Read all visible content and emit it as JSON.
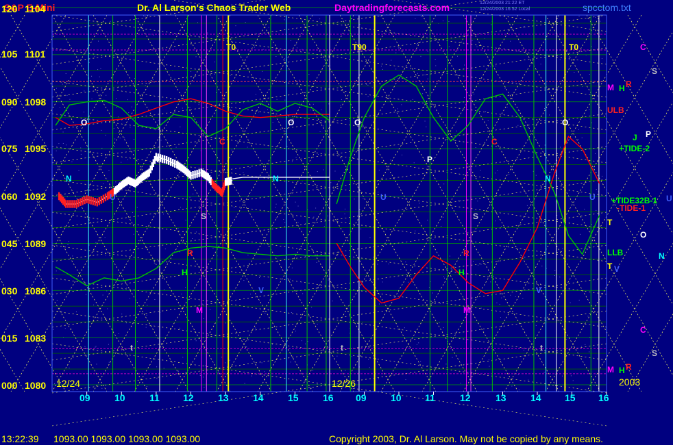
{
  "header": {
    "symbol": "S&P E-Mini",
    "title": "Dr. Al Larson's Chaos Trader Web",
    "site": "Daytradingforecasts.com",
    "stamp1": "12/24/2003 21:22 ET",
    "stamp2": "12/24/2003 16:52 Local",
    "file": "spcctom.txt"
  },
  "footer": {
    "time": "13:22:39",
    "quotes": "1093.00 1093.00 1093.00 1093.00",
    "copyright": "Copyright 2003, Dr. Al Larson. May not be copied by any means."
  },
  "colors": {
    "background": "#000080",
    "grid_green": "#00c000",
    "grid_yellow": "#ffff00",
    "cyan": "#00ffff",
    "magenta": "#ff00ff",
    "red": "#ff0000",
    "white": "#ffffff"
  },
  "chart_data": {
    "type": "line",
    "left_axis_labels": [
      "120",
      "105",
      "090",
      "075",
      "060",
      "045",
      "030",
      "015",
      "000"
    ],
    "price_axis_labels": [
      "1104",
      "1101",
      "1098",
      "1095",
      "1092",
      "1089",
      "1086",
      "1083",
      "1080"
    ],
    "ylim": [
      1080,
      1104
    ],
    "x_ticks_day1": [
      "09",
      "10",
      "11",
      "12",
      "13",
      "14",
      "15",
      "16"
    ],
    "x_ticks_day2": [
      "09",
      "10",
      "11",
      "12",
      "13",
      "14",
      "15",
      "16"
    ],
    "dates": [
      "12/24",
      "12/26"
    ],
    "year": "2003",
    "markers": {
      "T0": "T0",
      "T90": "T90",
      "T0b": "T0"
    },
    "right_labels": {
      "ulb": "ULB",
      "llb": "LLB",
      "tide2": "+TIDE-2",
      "tide32b": "+TIDE32B-1",
      "tide1": "-TIDE-1"
    },
    "planet_letters": [
      "C",
      "S",
      "M",
      "H",
      "R",
      "J",
      "P",
      "U",
      "T",
      "O",
      "N",
      "V",
      "t"
    ],
    "series": [
      {
        "color": "#ffffff",
        "points": [
          [
            8.2,
            1092.0
          ],
          [
            8.4,
            1091.5
          ],
          [
            8.7,
            1091.5
          ],
          [
            9.0,
            1091.8
          ],
          [
            9.3,
            1091.6
          ],
          [
            9.6,
            1092.0
          ],
          [
            9.8,
            1092.3
          ],
          [
            10.0,
            1092.7
          ],
          [
            10.2,
            1093.0
          ],
          [
            10.4,
            1092.8
          ],
          [
            10.6,
            1093.2
          ],
          [
            10.8,
            1093.5
          ],
          [
            11.0,
            1094.5
          ],
          [
            11.3,
            1094.3
          ],
          [
            11.6,
            1094.0
          ],
          [
            11.8,
            1093.7
          ],
          [
            12.0,
            1093.3
          ],
          [
            12.3,
            1093.5
          ],
          [
            12.5,
            1093.2
          ],
          [
            12.7,
            1092.6
          ],
          [
            12.9,
            1092.2
          ],
          [
            13.0,
            1092.9
          ],
          [
            13.2,
            1093.0
          ]
        ]
      },
      {
        "color": "#ff0000",
        "points": [
          [
            8.1,
            1097.0
          ],
          [
            8.5,
            1096.5
          ],
          [
            9.0,
            1096.6
          ],
          [
            9.5,
            1096.8
          ],
          [
            10.0,
            1096.9
          ],
          [
            10.5,
            1097.2
          ],
          [
            11.0,
            1097.6
          ],
          [
            11.5,
            1098.0
          ],
          [
            12.0,
            1098.2
          ],
          [
            12.5,
            1097.9
          ],
          [
            13.0,
            1097.4
          ],
          [
            13.5,
            1097.1
          ],
          [
            14.0,
            1097.0
          ],
          [
            14.5,
            1097.1
          ],
          [
            15.0,
            1097.2
          ],
          [
            15.5,
            1097.2
          ],
          [
            16.0,
            1097.2
          ]
        ]
      },
      {
        "color": "#00c000",
        "points": [
          [
            8.1,
            1096.5
          ],
          [
            8.5,
            1097.8
          ],
          [
            9.0,
            1098.0
          ],
          [
            9.5,
            1098.1
          ],
          [
            10.0,
            1097.6
          ],
          [
            10.5,
            1096.5
          ],
          [
            11.0,
            1096.3
          ],
          [
            11.5,
            1097.2
          ],
          [
            12.0,
            1097.0
          ],
          [
            12.5,
            1095.8
          ],
          [
            13.0,
            1096.3
          ],
          [
            13.5,
            1097.5
          ],
          [
            14.0,
            1097.9
          ],
          [
            14.5,
            1097.4
          ],
          [
            15.0,
            1097.9
          ],
          [
            15.5,
            1097.6
          ],
          [
            16.0,
            1096.8
          ]
        ]
      },
      {
        "color": "#00c000",
        "points": [
          [
            8.1,
            1087.5
          ],
          [
            8.5,
            1087.0
          ],
          [
            9.0,
            1086.3
          ],
          [
            9.5,
            1086.8
          ],
          [
            10.0,
            1086.6
          ],
          [
            10.5,
            1086.8
          ],
          [
            11.0,
            1087.4
          ],
          [
            11.5,
            1088.4
          ],
          [
            12.0,
            1088.7
          ],
          [
            12.5,
            1088.8
          ],
          [
            13.0,
            1088.7
          ],
          [
            13.5,
            1088.4
          ],
          [
            14.0,
            1088.3
          ],
          [
            14.5,
            1088.2
          ],
          [
            15.0,
            1088.3
          ],
          [
            15.5,
            1088.2
          ],
          [
            16.0,
            1088.2
          ]
        ]
      },
      {
        "color": "#ff0000",
        "points": [
          [
            16.2,
            1089.0
          ],
          [
            16.6,
            1087.5
          ],
          [
            17.0,
            1086.2
          ],
          [
            17.5,
            1085.2
          ],
          [
            18.0,
            1085.5
          ],
          [
            18.5,
            1087.0
          ],
          [
            19.0,
            1088.2
          ],
          [
            19.5,
            1087.6
          ],
          [
            20.0,
            1086.5
          ],
          [
            20.5,
            1085.8
          ],
          [
            21.0,
            1086.0
          ],
          [
            21.5,
            1087.8
          ],
          [
            22.0,
            1090.0
          ],
          [
            22.5,
            1093.5
          ],
          [
            22.9,
            1095.8
          ],
          [
            23.3,
            1095.0
          ],
          [
            23.8,
            1092.8
          ]
        ]
      },
      {
        "color": "#00c000",
        "points": [
          [
            16.2,
            1091.5
          ],
          [
            16.6,
            1094.5
          ],
          [
            17.0,
            1097.0
          ],
          [
            17.5,
            1099.0
          ],
          [
            18.0,
            1099.7
          ],
          [
            18.5,
            1099.0
          ],
          [
            19.0,
            1097.0
          ],
          [
            19.5,
            1095.5
          ],
          [
            20.0,
            1096.5
          ],
          [
            20.5,
            1098.2
          ],
          [
            21.0,
            1098.5
          ],
          [
            21.5,
            1097.0
          ],
          [
            22.0,
            1094.5
          ],
          [
            22.5,
            1092.2
          ],
          [
            22.9,
            1089.5
          ],
          [
            23.3,
            1088.3
          ],
          [
            23.8,
            1090.8
          ]
        ]
      },
      {
        "color": "#ffffff",
        "points": [
          [
            13.2,
            1093.1
          ],
          [
            13.5,
            1093.2
          ],
          [
            14.0,
            1093.2
          ],
          [
            15.0,
            1093.2
          ],
          [
            16.0,
            1093.2
          ]
        ]
      }
    ]
  }
}
